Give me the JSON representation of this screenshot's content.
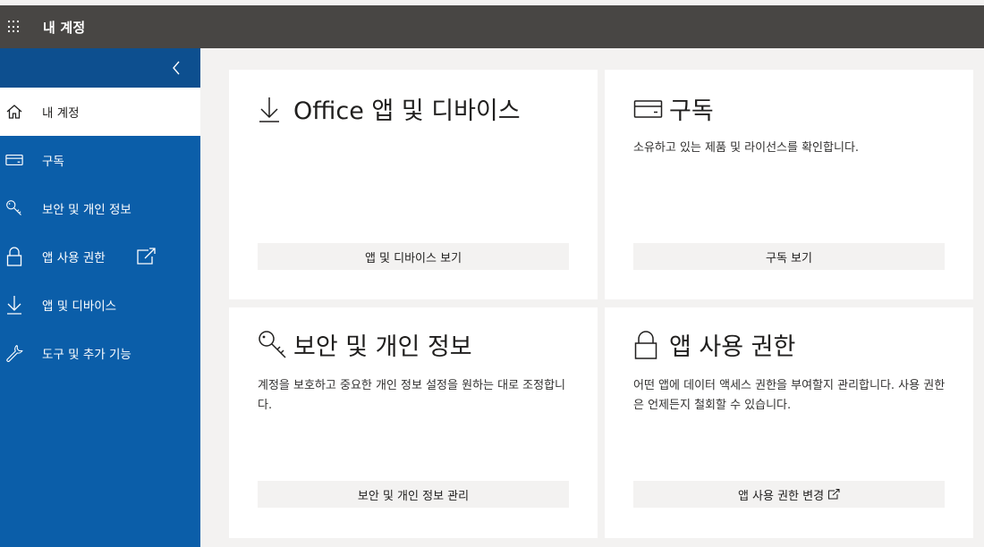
{
  "header": {
    "title": "내 계정"
  },
  "sidebar": {
    "items": [
      {
        "label": "내 계정",
        "icon": "home-icon"
      },
      {
        "label": "구독",
        "icon": "card-icon"
      },
      {
        "label": "보안 및 개인 정보",
        "icon": "key-icon"
      },
      {
        "label": "앱 사용 권한",
        "icon": "lock-icon"
      },
      {
        "label": "앱 및 디바이스",
        "icon": "download-icon"
      },
      {
        "label": "도구 및 추가 기능",
        "icon": "wrench-icon"
      }
    ]
  },
  "cards": {
    "office": {
      "title": "Office 앱 및 디바이스",
      "button": "앱 및 디바이스 보기"
    },
    "subscriptions": {
      "title": "구독",
      "description": "소유하고 있는 제품 및 라이선스를 확인합니다.",
      "button": "구독 보기"
    },
    "security": {
      "title": "보안 및 개인 정보",
      "description": "계정을 보호하고 중요한 개인 정보 설정을 원하는 대로 조정합니다.",
      "button": "보안 및 개인 정보 관리"
    },
    "permissions": {
      "title": "앱 사용 권한",
      "description": "어떤 앱에 데이터 액세스 권한을 부여할지 관리합니다. 사용 권한은 언제든지 철회할 수 있습니다.",
      "button": "앱 사용 권한 변경"
    }
  },
  "colors": {
    "topbar": "#484644",
    "sidebar": "#0b5ea9",
    "sidebar_top": "#0d4f8f",
    "active": "#ffffff"
  }
}
